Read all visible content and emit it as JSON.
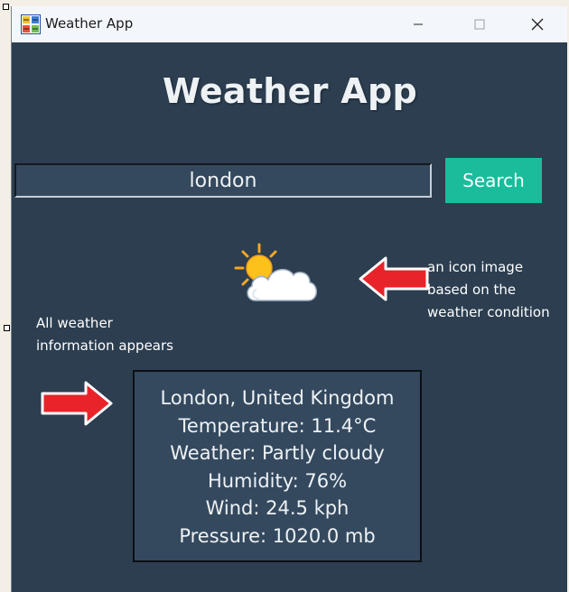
{
  "window": {
    "title": "Weather App"
  },
  "app": {
    "heading": "Weather App"
  },
  "search": {
    "value": "london",
    "button_label": "Search"
  },
  "weather_icon": {
    "icon": "partly-cloudy-icon",
    "condition": "Partly cloudy"
  },
  "annotations": {
    "icon_note_lines": [
      "an icon image",
      "based on the",
      "weather condition"
    ],
    "info_note_lines": [
      "All weather",
      "information appears"
    ],
    "arrow_color": "#e8242a"
  },
  "info": {
    "location": "London, United Kingdom",
    "temperature": "Temperature: 11.4°C",
    "weather": "Weather: Partly cloudy",
    "humidity": "Humidity: 76%",
    "wind": "Wind: 24.5 kph",
    "pressure": "Pressure: 1020.0 mb"
  },
  "colors": {
    "background": "#2c3e50",
    "panel": "#34495e",
    "accent": "#1abc9c",
    "text": "#eef2f5"
  }
}
